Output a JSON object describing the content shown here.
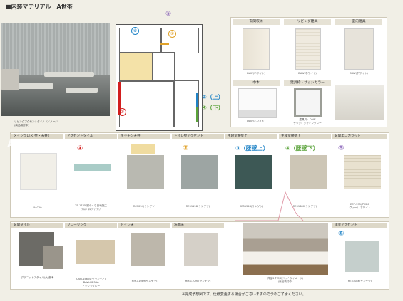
{
  "header": {
    "title": "■内装マテリアル　A世帯"
  },
  "watermark": "Able NetWork",
  "top_marker": "⑤",
  "photo_caption": "リビングアクセントタイル（イメージ）",
  "photo_caption2": "(商品検討中)",
  "floorplan": {
    "m1": "①",
    "m2": "②",
    "m6": "⑥",
    "m3": "③（上）",
    "m4": "④（下）"
  },
  "fixtures": {
    "headers": [
      "玄関収納",
      "リビング建具",
      "室内建具"
    ],
    "labels": [
      "DAW(ホワイト)",
      "DAW(ホワイト)",
      "DAW(ホワイト)"
    ],
    "headers2": [
      "巾木",
      "建具枠・サッシカラー"
    ],
    "labels2": [
      "DAW(ホワイト)",
      "建具枠：DAW",
      "サッシ：シャイングレー"
    ]
  },
  "row1": {
    "headers": [
      "メインクロス(壁・天井)",
      "アクセントタイル",
      "キッチン天井",
      "トイレ壁アクセント",
      "主寝室腰壁上",
      "主寝室腰壁下",
      "玄関エコカラット"
    ],
    "marks": [
      "①",
      "②",
      "③（腰壁上）",
      "④（腰壁下）",
      "⑤"
    ],
    "labels": [
      "DAC10",
      "ZS-1745 銀のくり目地施工",
      "(ｸﾛｽﾊﾟﾈﾙ ﾗｲﾌﾞﾗｲﾌ)",
      "RC7054(サンゲツ)",
      "RE51158(サンゲツ)",
      "RE51546(サンゲツ)",
      "RE51380(サンゲツ)",
      "ECP-395/TWD1",
      "ヴィーレ ホワイト"
    ]
  },
  "row2": {
    "headers": [
      "玄関タイル",
      "フローリング",
      "トイレ床",
      "洗面床",
      "",
      "",
      "洋室アクセント"
    ],
    "mark": "⑥",
    "labels": [
      "グラニットスタイル(大)参考",
      "CAN-1560S(グランディ)",
      "DAW-HB34A",
      "アッシュグレー",
      "HM-11089(サンゲツ)",
      "HM-11090(サンゲツ)",
      "洋室2クロス(ﾍﾞｯﾄﾞのイメージ)",
      "(商品検討中)",
      "RE51086(サンゲツ)"
    ]
  },
  "footnote": "※完成予想図です。仕様変更する場合がございますので予めご了承ください。",
  "colors": {
    "red": "#d21e1e",
    "orange": "#e0a22a",
    "blue": "#1f83c6",
    "green": "#5aa33a",
    "purple": "#7a4fb0"
  }
}
